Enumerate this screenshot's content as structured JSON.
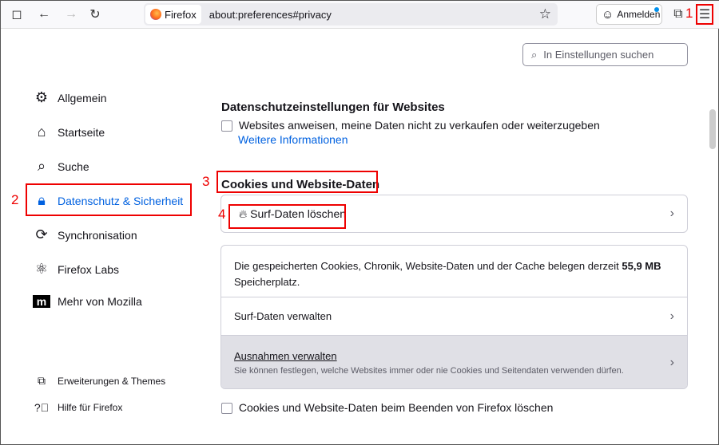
{
  "browser": {
    "tab_label": "Firefox",
    "url": "about:preferences#privacy",
    "signin": "Anmelden"
  },
  "search": {
    "placeholder": "In Einstellungen suchen"
  },
  "sidebar": {
    "items": [
      {
        "label": "Allgemein"
      },
      {
        "label": "Startseite"
      },
      {
        "label": "Suche"
      },
      {
        "label": "Datenschutz & Sicherheit"
      },
      {
        "label": "Synchronisation"
      },
      {
        "label": "Firefox Labs"
      },
      {
        "label": "Mehr von Mozilla"
      }
    ],
    "footer": [
      {
        "label": "Erweiterungen & Themes"
      },
      {
        "label": "Hilfe für Firefox"
      }
    ]
  },
  "main": {
    "privacy_heading": "Datenschutzeinstellungen für Websites",
    "dnt_label": "Websites anweisen, meine Daten nicht zu verkaufen oder weiterzugeben",
    "more_info": "Weitere Informationen",
    "cookies_heading": "Cookies und Website-Daten",
    "clear_data": "Surf-Daten löschen",
    "storage_text": "Die gespeicherten Cookies, Chronik, Website-Daten und der Cache belegen derzeit",
    "storage_size": "55,9 MB",
    "storage_suffix": "Speicherplatz.",
    "manage_data": "Surf-Daten verwalten",
    "exceptions": "Ausnahmen verwalten",
    "exceptions_desc": "Sie können festlegen, welche Websites immer oder nie Cookies und Seitendaten verwenden dürfen.",
    "delete_on_close": "Cookies und Website-Daten beim Beenden von Firefox löschen"
  },
  "annotations": [
    "1",
    "2",
    "3",
    "4"
  ]
}
